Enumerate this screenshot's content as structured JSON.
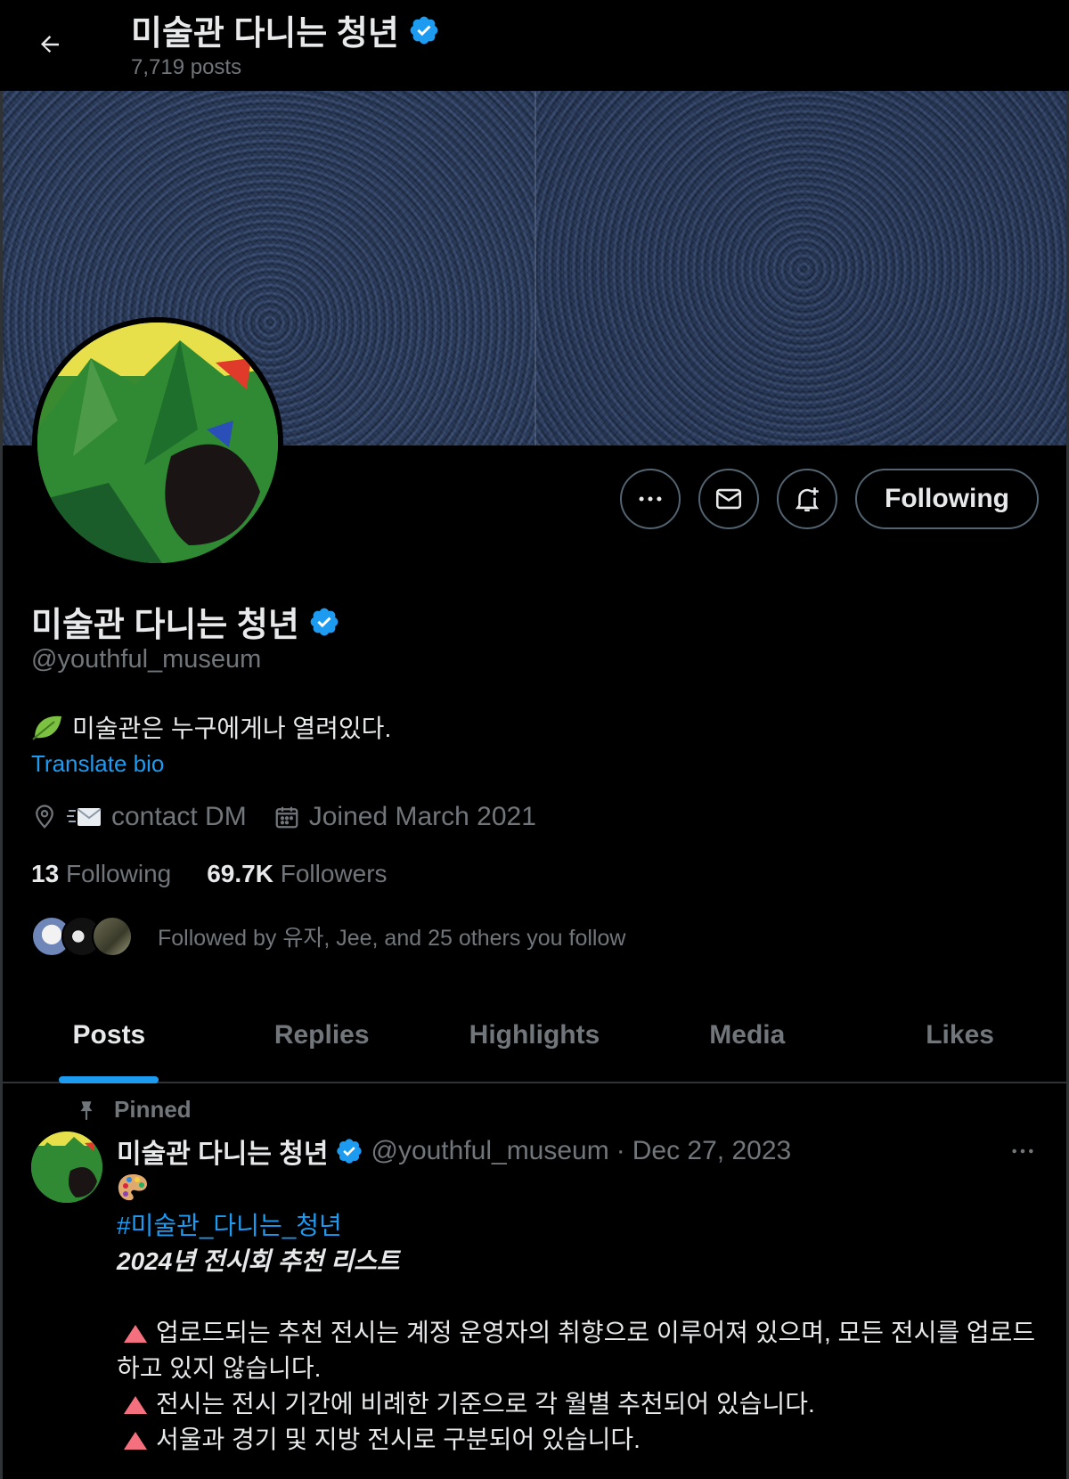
{
  "header": {
    "title": "미술관 다니는 청년",
    "posts_count": "7,719 posts"
  },
  "profile": {
    "display_name": "미술관 다니는 청년",
    "handle": "@youthful_museum",
    "bio": "미술관은 누구에게나 열려있다.",
    "translate_label": "Translate bio",
    "location": "contact DM",
    "joined": "Joined March 2021",
    "following_count": "13",
    "following_label": "Following",
    "followers_count": "69.7K",
    "followers_label": "Followers",
    "followed_by": "Followed by 유자, Jee, and 25 others you follow"
  },
  "actions": {
    "following_button": "Following"
  },
  "tabs": [
    {
      "label": "Posts",
      "active": true
    },
    {
      "label": "Replies",
      "active": false
    },
    {
      "label": "Highlights",
      "active": false
    },
    {
      "label": "Media",
      "active": false
    },
    {
      "label": "Likes",
      "active": false
    }
  ],
  "tweet": {
    "pinned_label": "Pinned",
    "author_name": "미술관 다니는 청년",
    "author_handle": "@youthful_museum",
    "separator": "·",
    "date": "Dec 27, 2023",
    "hashtag": "#미술관_다니는_청년",
    "headline": "2024년 전시회 추천 리스트",
    "notes": [
      "업로드되는 추천 전시는 계정 운영자의 취향으로 이루어져 있으며, 모든 전시를 업로드하고 있지 않습니다.",
      "전시는 전시 기간에 비례한 기준으로 각 월별 추천되어 있습니다.",
      "서울과 경기 및 지방 전시로 구분되어 있습니다."
    ]
  },
  "colors": {
    "accent": "#1d9bf0",
    "background": "#000000",
    "text_primary": "#e7e9ea",
    "text_secondary": "#71767b",
    "triangle": "#f4707f"
  }
}
